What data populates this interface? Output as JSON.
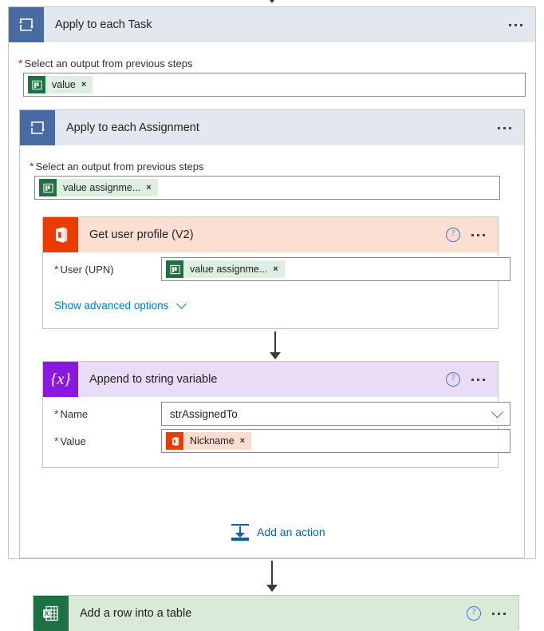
{
  "colors": {
    "loop_header_bg": "#e3e7ee",
    "loop_icon_bg": "#486ca1",
    "office_orange": "#eb3c00",
    "office_header_bg": "#fbdfd3",
    "variable_purple": "#8a18e0",
    "variable_header_bg": "#e9dcf7",
    "excel_green": "#1e7145",
    "excel_header_bg": "#d9ead9",
    "link_blue": "#0078d4",
    "required_red": "#a4262c"
  },
  "outer_loop": {
    "title": "Apply to each Task",
    "icon": "loop-icon",
    "more_menu": "more-options",
    "input_label": "Select an output from previous steps",
    "required_marker": "*",
    "token": {
      "text": "value",
      "icon": "planner-icon",
      "remove": "×"
    }
  },
  "inner_loop": {
    "title": "Apply to each Assignment",
    "icon": "loop-icon",
    "more_menu": "more-options",
    "input_label": "Select an output from previous steps",
    "required_marker": "*",
    "token": {
      "text": "value assignme...",
      "icon": "planner-icon",
      "remove": "×"
    }
  },
  "get_user_profile": {
    "title": "Get user profile (V2)",
    "icon": "office365-icon",
    "help": "?",
    "more_menu": "more-options",
    "field_label": "User (UPN)",
    "required_marker": "*",
    "token": {
      "text": "value assignme...",
      "icon": "planner-icon",
      "remove": "×"
    },
    "advanced_link": "Show advanced options"
  },
  "append_variable": {
    "title": "Append to string variable",
    "icon": "variable-braces-icon",
    "help": "?",
    "more_menu": "more-options",
    "name_label": "Name",
    "name_value": "strAssignedTo",
    "name_required_marker": "*",
    "value_label": "Value",
    "value_required_marker": "*",
    "value_token": {
      "text": "Nickname",
      "icon": "office365-icon",
      "remove": "×"
    }
  },
  "add_action": {
    "label": "Add an action",
    "icon": "add-action-icon"
  },
  "excel_action": {
    "title": "Add a row into a table",
    "icon": "excel-icon",
    "help": "?",
    "more_menu": "more-options"
  }
}
